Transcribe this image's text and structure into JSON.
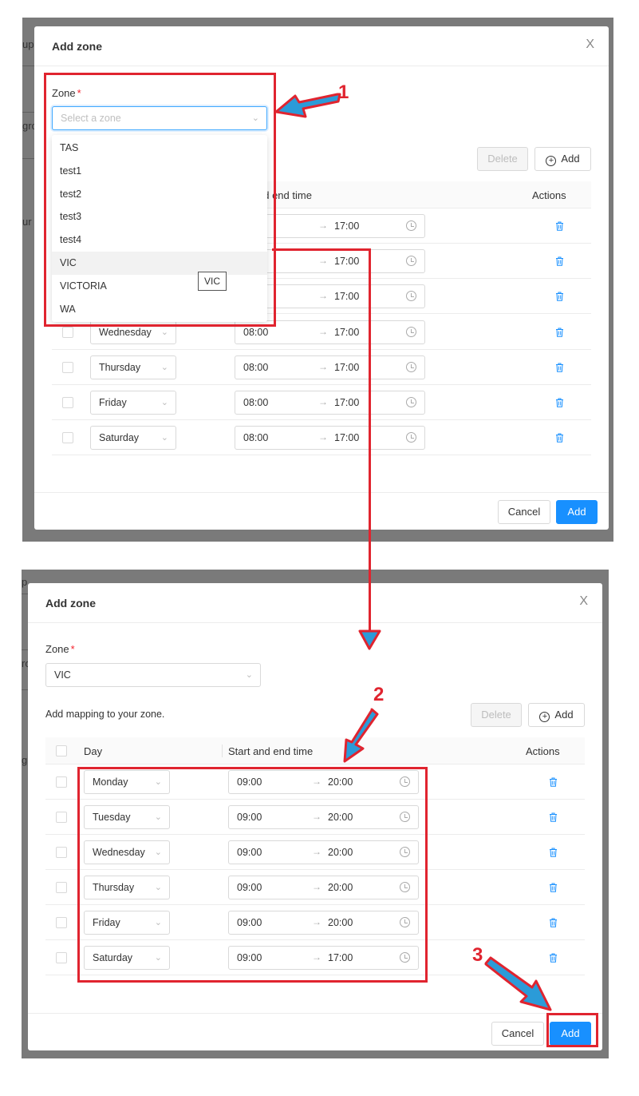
{
  "top_panel": {
    "background_fragments": [
      "up",
      "gro",
      "ur g"
    ],
    "modal": {
      "title": "Add zone",
      "close_symbol": "X",
      "zone_label": "Zone",
      "required_mark": "*",
      "zone_placeholder": "Select a zone",
      "delete_label": "Delete",
      "add_label": "Add",
      "column_time": "nd end time",
      "column_actions": "Actions",
      "dropdown_options": [
        "TAS",
        "test1",
        "test2",
        "test3",
        "test4",
        "VIC",
        "VICTORIA",
        "WA"
      ],
      "dropdown_highlighted": "VIC",
      "tooltip": "VIC",
      "partial_rows": [
        {
          "end": "17:00"
        },
        {
          "end": "17:00"
        },
        {
          "end": "17:00"
        }
      ],
      "rows": [
        {
          "day": "Wednesday",
          "start": "08:00",
          "end": "17:00"
        },
        {
          "day": "Thursday",
          "start": "08:00",
          "end": "17:00"
        },
        {
          "day": "Friday",
          "start": "08:00",
          "end": "17:00"
        },
        {
          "day": "Saturday",
          "start": "08:00",
          "end": "17:00"
        }
      ],
      "cancel_label": "Cancel",
      "submit_label": "Add"
    }
  },
  "bottom_panel": {
    "background_fragments": [
      "p",
      "ro",
      "g"
    ],
    "modal": {
      "title": "Add zone",
      "close_symbol": "X",
      "zone_label": "Zone",
      "required_mark": "*",
      "zone_value": "VIC",
      "hint": "Add mapping to your zone.",
      "delete_label": "Delete",
      "add_label": "Add",
      "column_day": "Day",
      "column_time": "Start and end time",
      "column_actions": "Actions",
      "rows": [
        {
          "day": "Monday",
          "start": "09:00",
          "end": "20:00"
        },
        {
          "day": "Tuesday",
          "start": "09:00",
          "end": "20:00"
        },
        {
          "day": "Wednesday",
          "start": "09:00",
          "end": "20:00"
        },
        {
          "day": "Thursday",
          "start": "09:00",
          "end": "20:00"
        },
        {
          "day": "Friday",
          "start": "09:00",
          "end": "20:00"
        },
        {
          "day": "Saturday",
          "start": "09:00",
          "end": "17:00"
        }
      ],
      "cancel_label": "Cancel",
      "submit_label": "Add"
    }
  },
  "annotations": {
    "step1": "1",
    "step2": "2",
    "step3": "3",
    "color_red": "#e0242f",
    "color_arrow_fill": "#2b9bd8"
  },
  "colors": {
    "primary": "#1890ff",
    "delete_icon": "#1890ff",
    "required": "#f5222d"
  }
}
